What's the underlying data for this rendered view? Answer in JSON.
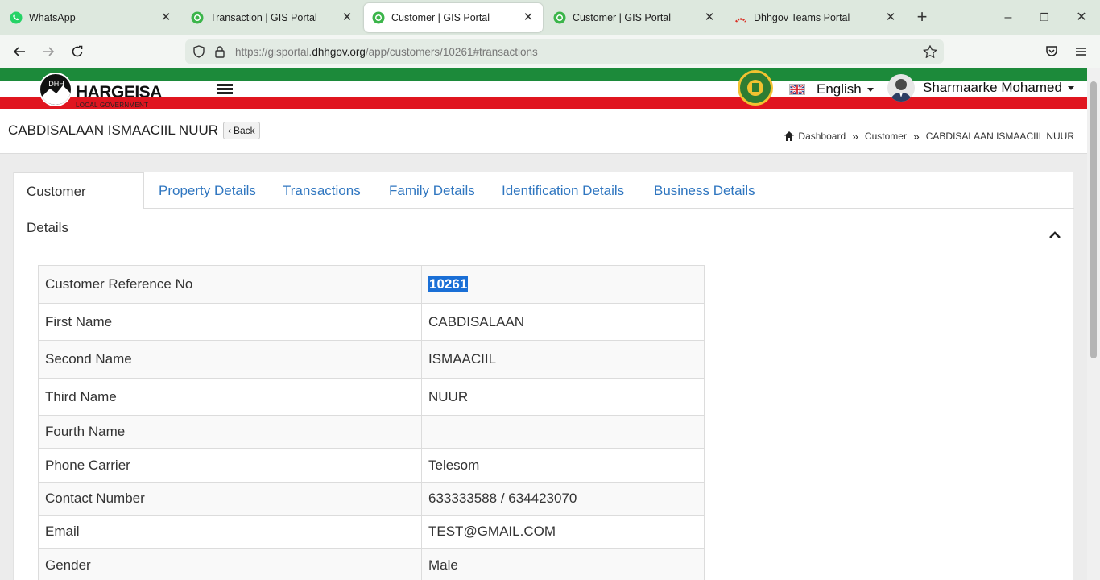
{
  "browser": {
    "tabs": [
      {
        "title": "WhatsApp",
        "icon": "whatsapp-icon"
      },
      {
        "title": "Transaction | GIS Portal",
        "icon": "gis-portal-icon"
      },
      {
        "title": "Customer | GIS Portal",
        "icon": "gis-portal-icon",
        "active": true
      },
      {
        "title": "Customer | GIS Portal",
        "icon": "gis-portal-icon"
      },
      {
        "title": "Dhhgov Teams Portal",
        "icon": "teams-portal-icon"
      }
    ],
    "url_prefix": "https://gisportal.",
    "url_host": "dhhgov.org",
    "url_path": "/app/customers/10261#transactions"
  },
  "header": {
    "logo_title": "HARGEISA",
    "logo_subtitle": "LOCAL GOVERNMENT",
    "logo_letters": "DHH",
    "language": "English",
    "user_name": "Sharmaarke Mohamed"
  },
  "page": {
    "title": "CABDISALAAN ISMAACIIL NUUR",
    "back_label": "Back",
    "breadcrumb": [
      "Dashboard",
      "Customer",
      "CABDISALAAN ISMAACIIL NUUR"
    ]
  },
  "tabs": [
    "Customer Details",
    "Property Details",
    "Transactions",
    "Family Details",
    "Identification Details",
    "Business Details"
  ],
  "details": [
    {
      "label": "Customer Reference No",
      "value": "10261"
    },
    {
      "label": "First Name",
      "value": "CABDISALAAN"
    },
    {
      "label": "Second Name",
      "value": "ISMAACIIL"
    },
    {
      "label": "Third Name",
      "value": "NUUR"
    },
    {
      "label": "Fourth Name",
      "value": ""
    },
    {
      "label": "Phone Carrier",
      "value": "Telesom"
    },
    {
      "label": "Contact Number",
      "value": "633333588 / 634423070"
    },
    {
      "label": "Email",
      "value": "TEST@GMAIL.COM"
    },
    {
      "label": "Gender",
      "value": "Male"
    }
  ],
  "colors": {
    "link": "#2f76c0",
    "flag_green": "#1c8a3a",
    "flag_red": "#e0151f",
    "selection": "#1a6fd6"
  }
}
